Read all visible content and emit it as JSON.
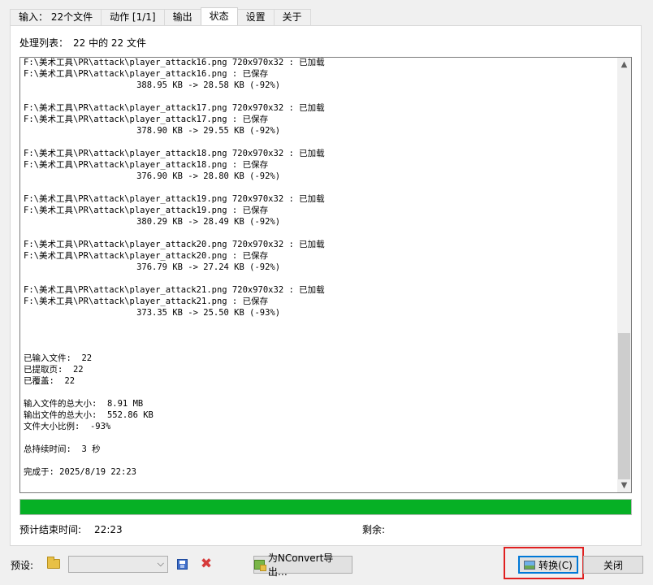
{
  "tabs": [
    {
      "label": "输入： 22个文件"
    },
    {
      "label": "动作 [1/1]"
    },
    {
      "label": "输出"
    },
    {
      "label": "状态"
    },
    {
      "label": "设置"
    },
    {
      "label": "关于"
    }
  ],
  "status": {
    "process_label": "处理列表：",
    "process_count": "22 中的 22 文件",
    "log_lines": [
      "F:\\美术工具\\PR\\attack\\player_attack16.png 720x970x32 : 已加载",
      "F:\\美术工具\\PR\\attack\\player_attack16.png : 已保存",
      "                      388.95 KB -> 28.58 KB (-92%)",
      "",
      "F:\\美术工具\\PR\\attack\\player_attack17.png 720x970x32 : 已加载",
      "F:\\美术工具\\PR\\attack\\player_attack17.png : 已保存",
      "                      378.90 KB -> 29.55 KB (-92%)",
      "",
      "F:\\美术工具\\PR\\attack\\player_attack18.png 720x970x32 : 已加载",
      "F:\\美术工具\\PR\\attack\\player_attack18.png : 已保存",
      "                      376.90 KB -> 28.80 KB (-92%)",
      "",
      "F:\\美术工具\\PR\\attack\\player_attack19.png 720x970x32 : 已加载",
      "F:\\美术工具\\PR\\attack\\player_attack19.png : 已保存",
      "                      380.29 KB -> 28.49 KB (-92%)",
      "",
      "F:\\美术工具\\PR\\attack\\player_attack20.png 720x970x32 : 已加载",
      "F:\\美术工具\\PR\\attack\\player_attack20.png : 已保存",
      "                      376.79 KB -> 27.24 KB (-92%)",
      "",
      "F:\\美术工具\\PR\\attack\\player_attack21.png 720x970x32 : 已加载",
      "F:\\美术工具\\PR\\attack\\player_attack21.png : 已保存",
      "                      373.35 KB -> 25.50 KB (-93%)",
      "",
      "",
      "",
      "已输入文件:  22",
      "已提取页:  22",
      "已覆盖:  22",
      "",
      "输入文件的总大小:  8.91 MB",
      "输出文件的总大小:  552.86 KB",
      "文件大小比例:  -93%",
      "",
      "总持续时间:  3 秒",
      "",
      "完成于: 2025/8/19 22:23"
    ],
    "progress_fraction": 1.0,
    "eta_label": "预计结束时间:",
    "eta_value": "22:23",
    "remaining_label": "剩余:"
  },
  "bottom": {
    "preset_label": "预设:",
    "preset_value": "",
    "export_label": "为NConvert导出…",
    "convert_label": "转换(C)",
    "close_label": "关闭"
  },
  "colors": {
    "progress": "#06b025",
    "highlight": "#e02020"
  }
}
